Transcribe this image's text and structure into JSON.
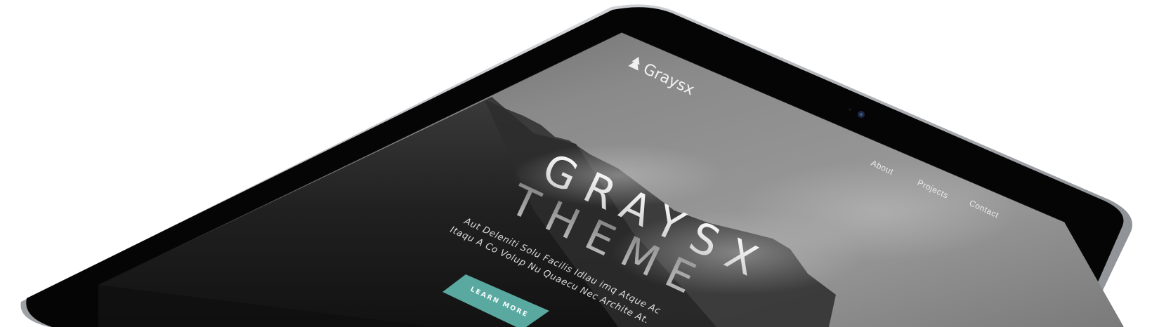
{
  "brand": {
    "name": "Graysx",
    "logo_icon": "tree-icon"
  },
  "nav": {
    "items": [
      {
        "label": "About"
      },
      {
        "label": "Projects"
      },
      {
        "label": "Contact"
      }
    ]
  },
  "hero": {
    "title_line1": "GRAYSX",
    "title_line2": "THEME",
    "description_line1": "Aut Deleniti Solu Facilis Idlau imq Atque Ac",
    "description_line2": "Itaqu A Co Volup Nu Quaecu Nec Archite At.",
    "cta_label": "LEARN MORE"
  },
  "colors": {
    "accent": "#5aa9a0",
    "device_bezel": "#050505",
    "device_frame": "#b9bcc0",
    "screen_dark": "#1c1c1c",
    "screen_sky": "#7e7e7e"
  }
}
